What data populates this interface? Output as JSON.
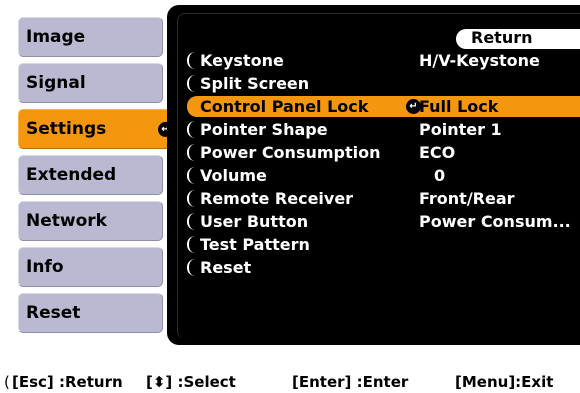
{
  "sidebar": {
    "tabs": [
      {
        "label": "Image"
      },
      {
        "label": "Signal"
      },
      {
        "label": "Settings",
        "active": true
      },
      {
        "label": "Extended"
      },
      {
        "label": "Network"
      },
      {
        "label": "Info"
      },
      {
        "label": "Reset"
      }
    ]
  },
  "panel": {
    "return_label": "Return",
    "rows": [
      {
        "label": "Keystone",
        "value": "H/V-Keystone"
      },
      {
        "label": "Split Screen",
        "value": ""
      },
      {
        "label": "Control Panel Lock",
        "value": "Full Lock",
        "selected": true
      },
      {
        "label": "Pointer Shape",
        "value": "Pointer 1"
      },
      {
        "label": "Power Consumption",
        "value": "ECO"
      },
      {
        "label": "Volume",
        "value": "0"
      },
      {
        "label": "Remote Receiver",
        "value": "Front/Rear"
      },
      {
        "label": "User Button",
        "value": "Power Consum..."
      },
      {
        "label": "Test Pattern",
        "value": ""
      },
      {
        "label": "Reset",
        "value": ""
      }
    ]
  },
  "footer": {
    "esc": "[Esc] :Return",
    "select": "[⬍] :Select",
    "enter": "[Enter] :Enter",
    "menu": "[Menu]:Exit"
  },
  "icons": {
    "enter": "enter-arrow-icon"
  },
  "colors": {
    "accent": "#f5960f",
    "tab": "#b9b9d2",
    "panel": "#000000"
  }
}
